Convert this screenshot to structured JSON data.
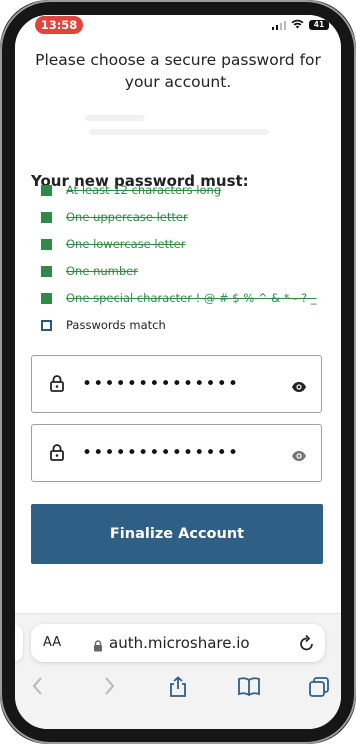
{
  "status_bar": {
    "time": "13:58",
    "battery": "41"
  },
  "intro": {
    "line1": "Please choose a secure password for",
    "line2": "your account."
  },
  "requirements": {
    "title": "Your new password must:",
    "items": [
      {
        "label": "At least 12 characters long",
        "met": true
      },
      {
        "label": "One uppercase letter",
        "met": true
      },
      {
        "label": "One lowercase letter",
        "met": true
      },
      {
        "label": "One number",
        "met": true
      },
      {
        "label": "One special character ! @ # $ % ^ & * - ? _",
        "met": true
      },
      {
        "label": "Passwords match",
        "met": false
      }
    ]
  },
  "password_field": {
    "masked_value": "••••••••••••••"
  },
  "confirm_field": {
    "masked_value": "••••••••••••••"
  },
  "finalize_button": {
    "label": "Finalize Account"
  },
  "browser": {
    "text_size_label": "AA",
    "url": "auth.microshare.io"
  },
  "colors": {
    "accent": "#2f5f85",
    "met": "#2e8b46",
    "time_pill": "#e0453c"
  },
  "icons": [
    "lock-icon",
    "eye-icon",
    "reload-icon",
    "back-icon",
    "forward-icon",
    "share-icon",
    "bookmarks-icon",
    "tabs-icon"
  ]
}
